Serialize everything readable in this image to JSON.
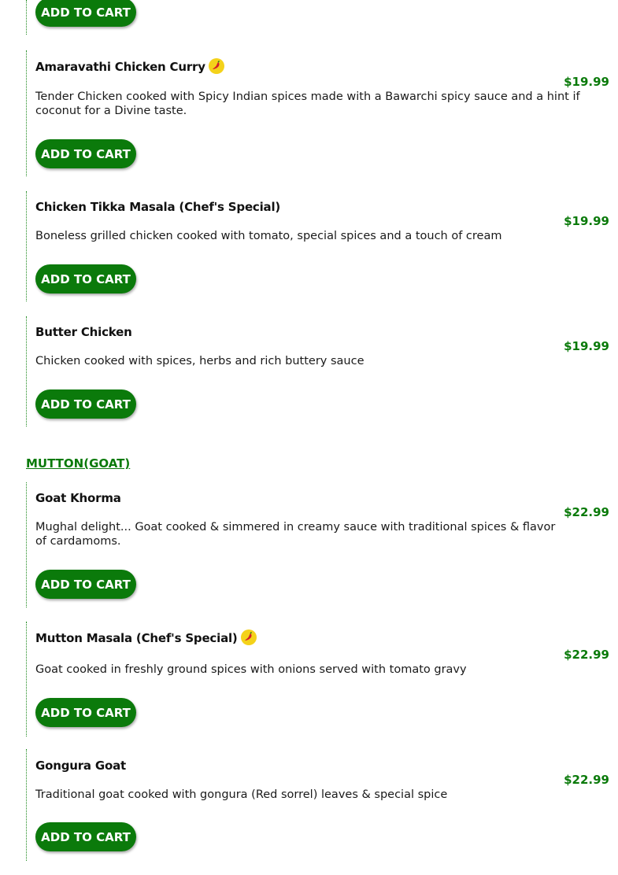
{
  "cart_label": "ADD TO CART",
  "sections": [
    {
      "title": "MUTTON(GOAT)"
    }
  ],
  "items": [
    {
      "name": "Amaravathi Chicken Curry",
      "spicy": true,
      "price": "$19.99",
      "description": "Tender Chicken cooked with Spicy Indian spices made with a Bawarchi spicy sauce and a hint if coconut for a Divine taste."
    },
    {
      "name": "Chicken Tikka Masala (Chef's Special)",
      "spicy": false,
      "price": "$19.99",
      "description": "Boneless grilled chicken cooked with tomato, special spices and a touch of cream"
    },
    {
      "name": "Butter Chicken",
      "spicy": false,
      "price": "$19.99",
      "description": "Chicken cooked with spices, herbs and rich buttery sauce"
    },
    {
      "name": "Goat Khorma",
      "spicy": false,
      "price": "$22.99",
      "description": "Mughal delight... Goat cooked & simmered in creamy sauce with traditional spices & flavor of cardamoms."
    },
    {
      "name": "Mutton Masala (Chef's Special)",
      "spicy": true,
      "price": "$22.99",
      "description": "Goat cooked in freshly ground spices with onions served with tomato gravy"
    },
    {
      "name": "Gongura Goat",
      "spicy": false,
      "price": "$22.99",
      "description": "Traditional goat cooked with gongura (Red sorrel) leaves & special spice"
    }
  ],
  "colors": {
    "accent": "#0b7a0b",
    "spicy_badge": "#f4d21a"
  },
  "icons": {
    "spicy": "chili-pepper-icon"
  }
}
